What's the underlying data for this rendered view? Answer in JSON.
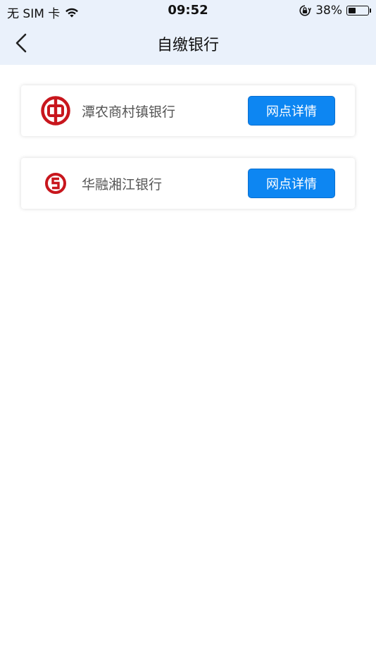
{
  "status_bar": {
    "carrier": "无 SIM 卡",
    "time": "09:52",
    "battery_percent": "38%",
    "battery_level": 0.38
  },
  "nav": {
    "title": "自缴银行"
  },
  "banks": [
    {
      "name": "潭农商村镇银行",
      "button_label": "网点详情",
      "logo_color": "#c8161d"
    },
    {
      "name": "华融湘江银行",
      "button_label": "网点详情",
      "logo_color": "#c8161d"
    }
  ],
  "colors": {
    "header_bg": "#eaf1fb",
    "accent": "#0d86f2"
  }
}
